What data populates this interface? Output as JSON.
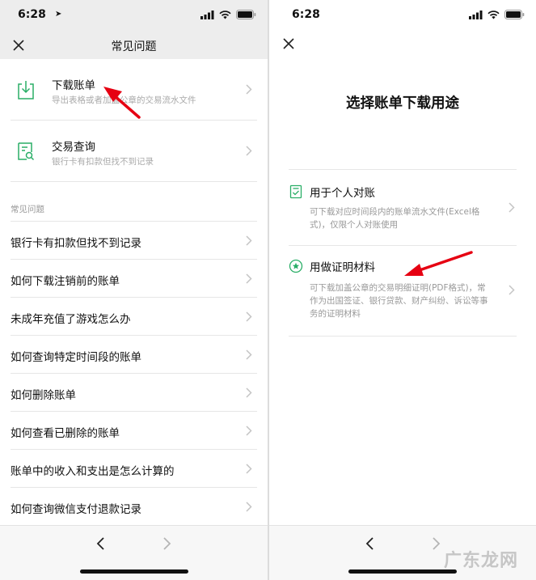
{
  "left": {
    "status": {
      "time": "6:28",
      "location_glyph": "➤"
    },
    "nav": {
      "title": "常见问题"
    },
    "featured": [
      {
        "title": "下载账单",
        "subtitle": "导出表格或者加盖公章的交易流水文件",
        "icon": "download-icon"
      },
      {
        "title": "交易查询",
        "subtitle": "银行卡有扣款但找不到记录",
        "icon": "search-document-icon"
      }
    ],
    "section_label": "常见问题",
    "questions": [
      "银行卡有扣款但找不到记录",
      "如何下载注销前的账单",
      "未成年充值了游戏怎么办",
      "如何查询特定时间段的账单",
      "如何删除账单",
      "如何查看已删除的账单",
      "账单中的收入和支出是怎么计算的",
      "如何查询微信支付退款记录"
    ]
  },
  "right": {
    "status": {
      "time": "6:28"
    },
    "title": "选择账单下载用途",
    "options": [
      {
        "title": "用于个人对账",
        "description": "可下载对应时间段内的账单流水文件(Excel格式)，仅限个人对账使用",
        "icon": "checklist-icon"
      },
      {
        "title": "用做证明材料",
        "description": "可下载加盖公章的交易明细证明(PDF格式)，常作为出国签证、银行贷款、财产纠纷、诉讼等事务的证明材料",
        "icon": "star-badge-icon"
      }
    ]
  },
  "watermark": "广东龙网",
  "colors": {
    "accent": "#07c160",
    "annotation_arrow": "#e60012",
    "header_bg": "#ededed"
  }
}
